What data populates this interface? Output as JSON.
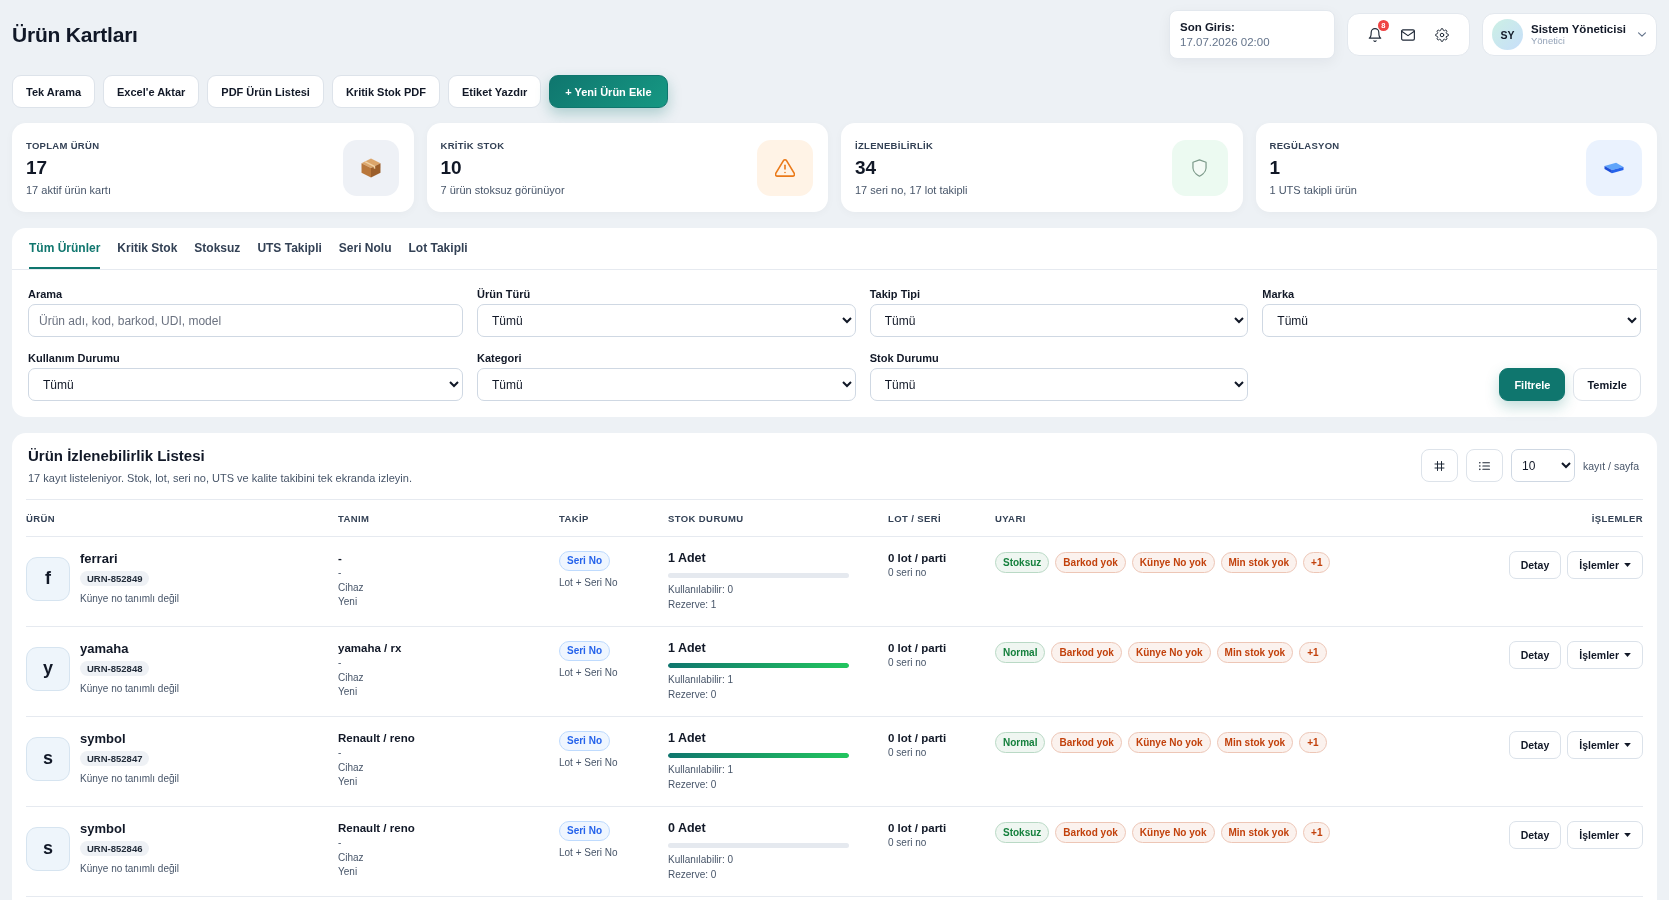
{
  "page": {
    "title": "Ürün Kartları"
  },
  "toolbar": [
    {
      "label": "Tek Arama",
      "kind": "default"
    },
    {
      "label": "Excel'e Aktar",
      "kind": "default"
    },
    {
      "label": "PDF Ürün Listesi",
      "kind": "default"
    },
    {
      "label": "Kritik Stok PDF",
      "kind": "default"
    },
    {
      "label": "Etiket Yazdır",
      "kind": "default"
    },
    {
      "label": "+ Yeni Ürün Ekle",
      "kind": "primary"
    }
  ],
  "last_login": {
    "label": "Son Giris:",
    "value": "17.07.2026 02:00"
  },
  "notifications": {
    "count": "8"
  },
  "user": {
    "initials": "SY",
    "name": "Sistem Yöneticisi",
    "role": "Yönetici"
  },
  "stats": [
    {
      "kind": "total",
      "label": "TOPLAM ÜRÜN",
      "value": "17",
      "caption": "17 aktif ürün kartı"
    },
    {
      "kind": "critical",
      "label": "KRİTİK STOK",
      "value": "10",
      "caption": "7 ürün stoksuz görünüyor"
    },
    {
      "kind": "traceability",
      "label": "İZLENEBİLİRLİK",
      "value": "34",
      "caption": "17 seri no, 17 lot takipli"
    },
    {
      "kind": "regulation",
      "label": "REGÜLASYON",
      "value": "1",
      "caption": "1 UTS takipli ürün"
    }
  ],
  "tabs": [
    {
      "label": "Tüm Ürünler",
      "selected": true
    },
    {
      "label": "Kritik Stok",
      "selected": false
    },
    {
      "label": "Stoksuz",
      "selected": false
    },
    {
      "label": "UTS Takipli",
      "selected": false
    },
    {
      "label": "Seri Nolu",
      "selected": false
    },
    {
      "label": "Lot Takipli",
      "selected": false
    }
  ],
  "filters": [
    {
      "label": "Arama",
      "kind": "text",
      "placeholder": "Ürün adı, kod, barkod, UDI, model"
    },
    {
      "label": "Ürün Türü",
      "kind": "select",
      "value": "Tümü"
    },
    {
      "label": "Takip Tipi",
      "kind": "select",
      "value": "Tümü"
    },
    {
      "label": "Marka",
      "kind": "select",
      "value": "Tümü"
    },
    {
      "label": "Kullanım Durumu",
      "kind": "select",
      "value": "Tümü"
    },
    {
      "label": "Kategori",
      "kind": "select",
      "value": "Tümü"
    },
    {
      "label": "Stok Durumu",
      "kind": "select",
      "value": "Tümü"
    }
  ],
  "filter_buttons": [
    {
      "label": "Filtrele",
      "kind": "primary"
    },
    {
      "label": "Temizle",
      "kind": "default"
    }
  ],
  "list": {
    "title": "Ürün İzlenebilirlik Listesi",
    "subtitle": "17 kayıt listeleniyor. Stok, lot, seri no, UTS ve kalite takibini tek ekranda izleyin.",
    "page_size": "10",
    "page_size_label": "kayıt / sayfa",
    "columns": [
      "ÜRÜN",
      "TANIM",
      "TAKİP",
      "STOK DURUMU",
      "LOT / SERİ",
      "UYARI",
      "İŞLEMLER"
    ],
    "rows": [
      {
        "initial": "f",
        "name": "ferrari",
        "code": "URN-852849",
        "note": "Künye no tanımlı değil",
        "definition": {
          "title": "-",
          "lines": [
            "-",
            "Cihaz",
            "Yeni"
          ]
        },
        "tracking": {
          "badge": "Seri No",
          "detail": "Lot + Seri No"
        },
        "stock": {
          "quantity": "1 Adet",
          "level": 0,
          "available": "Kullanılabilir: 0",
          "reserved": "Rezerve: 1"
        },
        "lot": {
          "lots": "0 lot / parti",
          "serials": "0 seri no"
        },
        "warnings": [
          {
            "label": "Stoksuz",
            "color": "#15803d"
          },
          {
            "label": "Barkod yok",
            "color": "#c2410c"
          },
          {
            "label": "Künye No yok",
            "color": "#c2410c"
          },
          {
            "label": "Min stok yok",
            "color": "#c2410c"
          },
          {
            "label": "+1",
            "color": "#c2410c"
          }
        ],
        "actions": [
          {
            "label": "Detay",
            "kind": "button"
          },
          {
            "label": "İşlemler",
            "kind": "menu"
          }
        ]
      },
      {
        "initial": "y",
        "name": "yamaha",
        "code": "URN-852848",
        "note": "Künye no tanımlı değil",
        "definition": {
          "title": "yamaha / rx",
          "lines": [
            "-",
            "Cihaz",
            "Yeni"
          ]
        },
        "tracking": {
          "badge": "Seri No",
          "detail": "Lot + Seri No"
        },
        "stock": {
          "quantity": "1 Adet",
          "level": 1,
          "available": "Kullanılabilir: 1",
          "reserved": "Rezerve: 0"
        },
        "lot": {
          "lots": "0 lot / parti",
          "serials": "0 seri no"
        },
        "warnings": [
          {
            "label": "Normal",
            "color": "#15803d"
          },
          {
            "label": "Barkod yok",
            "color": "#c2410c"
          },
          {
            "label": "Künye No yok",
            "color": "#c2410c"
          },
          {
            "label": "Min stok yok",
            "color": "#c2410c"
          },
          {
            "label": "+1",
            "color": "#c2410c"
          }
        ],
        "actions": [
          {
            "label": "Detay",
            "kind": "button"
          },
          {
            "label": "İşlemler",
            "kind": "menu"
          }
        ]
      },
      {
        "initial": "s",
        "name": "symbol",
        "code": "URN-852847",
        "note": "Künye no tanımlı değil",
        "definition": {
          "title": "Renault / reno",
          "lines": [
            "-",
            "Cihaz",
            "Yeni"
          ]
        },
        "tracking": {
          "badge": "Seri No",
          "detail": "Lot + Seri No"
        },
        "stock": {
          "quantity": "1 Adet",
          "level": 1,
          "available": "Kullanılabilir: 1",
          "reserved": "Rezerve: 0"
        },
        "lot": {
          "lots": "0 lot / parti",
          "serials": "0 seri no"
        },
        "warnings": [
          {
            "label": "Normal",
            "color": "#15803d"
          },
          {
            "label": "Barkod yok",
            "color": "#c2410c"
          },
          {
            "label": "Künye No yok",
            "color": "#c2410c"
          },
          {
            "label": "Min stok yok",
            "color": "#c2410c"
          },
          {
            "label": "+1",
            "color": "#c2410c"
          }
        ],
        "actions": [
          {
            "label": "Detay",
            "kind": "button"
          },
          {
            "label": "İşlemler",
            "kind": "menu"
          }
        ]
      },
      {
        "initial": "s",
        "name": "symbol",
        "code": "URN-852846",
        "note": "Künye no tanımlı değil",
        "definition": {
          "title": "Renault / reno",
          "lines": [
            "-",
            "Cihaz",
            "Yeni"
          ]
        },
        "tracking": {
          "badge": "Seri No",
          "detail": "Lot + Seri No"
        },
        "stock": {
          "quantity": "0 Adet",
          "level": 0,
          "available": "Kullanılabilir: 0",
          "reserved": "Rezerve: 0"
        },
        "lot": {
          "lots": "0 lot / parti",
          "serials": "0 seri no"
        },
        "warnings": [
          {
            "label": "Stoksuz",
            "color": "#15803d"
          },
          {
            "label": "Barkod yok",
            "color": "#c2410c"
          },
          {
            "label": "Künye No yok",
            "color": "#c2410c"
          },
          {
            "label": "Min stok yok",
            "color": "#c2410c"
          },
          {
            "label": "+1",
            "color": "#c2410c"
          }
        ],
        "actions": [
          {
            "label": "Detay",
            "kind": "button"
          },
          {
            "label": "İşlemler",
            "kind": "menu"
          }
        ]
      }
    ]
  }
}
